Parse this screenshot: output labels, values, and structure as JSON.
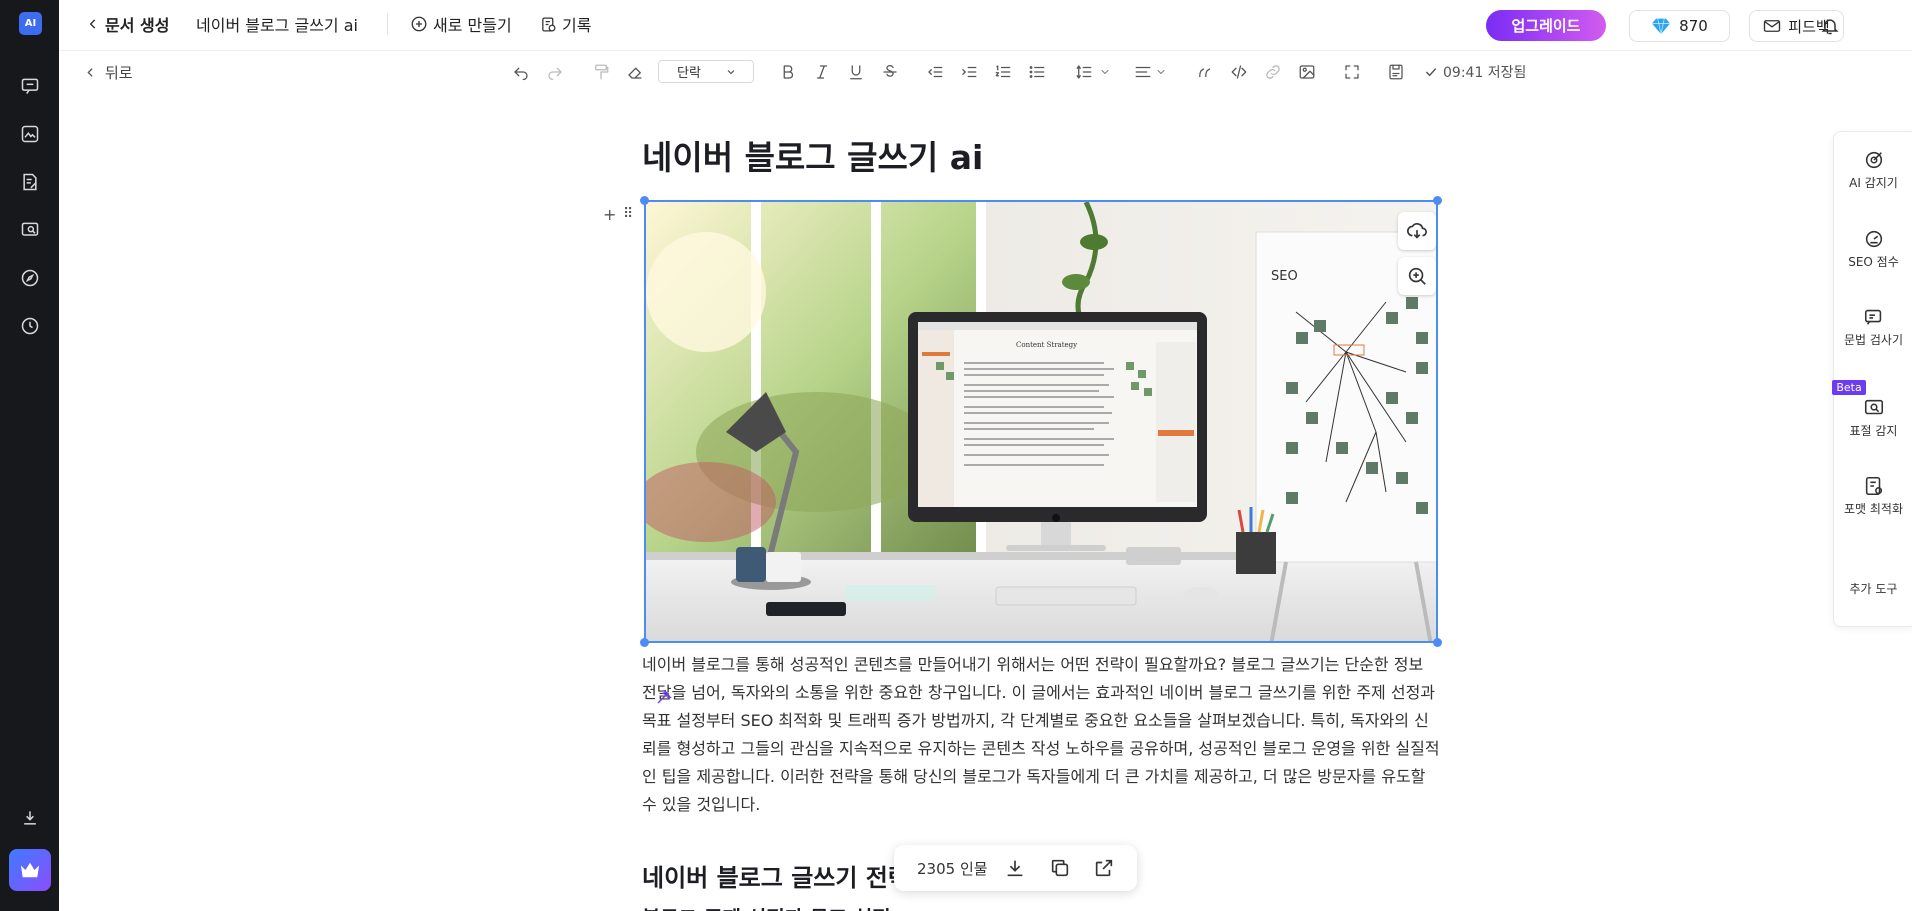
{
  "topbar": {
    "back_label": "문서 생성",
    "doc_name": "네이버 블로그 글쓰기 ai",
    "new_label": "새로 만들기",
    "history_label": "기록",
    "upgrade_label": "업그레이드",
    "credits": "870",
    "feedback_label": "피드백"
  },
  "toolbar": {
    "back_label": "뒤로",
    "paragraph_style": "단락",
    "saved_status": "09:41 저장됨"
  },
  "document": {
    "title": "네이버 블로그 글쓰기 ai",
    "paragraph": "네이버 블로그를 통해 성공적인 콘텐츠를 만들어내기 위해서는 어떤 전략이 필요할까요? 블로그 글쓰기는 단순한 정보 전달을 넘어, 독자와의 소통을 위한 중요한 창구입니다. 이 글에서는 효과적인 네이버 블로그 글쓰기를 위한 주제 선정과 목표 설정부터 SEO 최적화 및 트래픽 증가 방법까지, 각 단계별로 중요한 요소들을 살펴보겠습니다. 특히, 독자와의 신뢰를 형성하고 그들의 관심을 지속적으로 유지하는 콘텐츠 작성 노하우를 공유하며, 성공적인 블로그 운영을 위한 실질적인 팁을 제공합니다. 이러한 전략을 통해 당신의 블로그가 독자들에게 더 큰 가치를 제공하고, 더 많은 방문자를 유도할 수 있을 것입니다.",
    "heading2": "네이버 블로그 글쓰기 전략",
    "heading3": "블로그 주제 선정과 목표 설정"
  },
  "image": {
    "screen_title": "Content Strategy",
    "whiteboard_title": "SEO"
  },
  "count_bar": {
    "count": "2305 인물"
  },
  "right_panel": {
    "ai_detect": "AI 감지기",
    "seo_score": "SEO 점수",
    "grammar": "문법 검사기",
    "beta": "Beta",
    "plagiarism": "표절 감지",
    "format": "포맷 최적화",
    "more_tools": "추가 도구"
  },
  "colors": {
    "accent": "#4d8cf5",
    "sidebar_bg": "#17181c",
    "upgrade_start": "#7a2cf5",
    "upgrade_end": "#d35bf0"
  }
}
